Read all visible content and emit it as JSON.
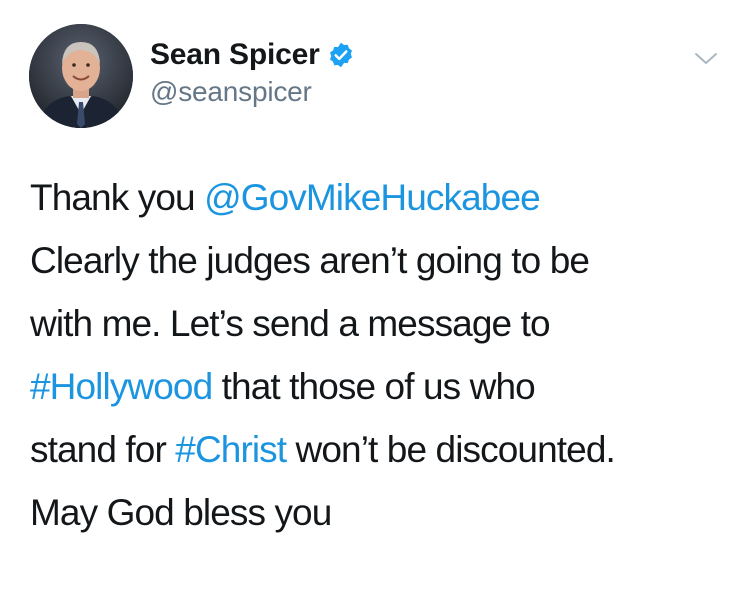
{
  "author": {
    "display_name": "Sean Spicer",
    "handle": "@seanspicer",
    "verified": true
  },
  "icons": {
    "verified": "verified-badge-icon",
    "menu": "chevron-down-icon"
  },
  "colors": {
    "link": "#1b95e0",
    "handle": "#657786",
    "verified": "#1da1f2",
    "text": "#14171a"
  },
  "tweet": {
    "line1_text": "Thank you ",
    "line1_mention": "@GovMikeHuckabee",
    "line2": "Clearly the judges aren’t going to be",
    "line3": "with me.  Let’s send a message to",
    "line4_hashtag": "#Hollywood",
    "line4_text": " that those of us who",
    "line5_text": "stand for ",
    "line5_hashtag": "#Christ",
    "line5_rest": " won’t be discounted.",
    "line6": "May God bless you"
  }
}
